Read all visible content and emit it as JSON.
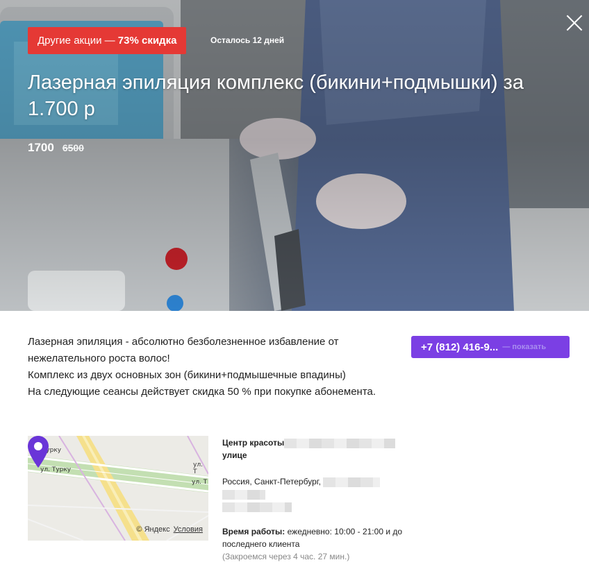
{
  "promo": {
    "badge_prefix": "Другие акции — ",
    "badge_discount": "73% скидка",
    "days_left": "Осталось 12 дней"
  },
  "offer": {
    "title": "Лазерная эпиляция комплекс (бикини+подмышки) за 1.700 р",
    "price_new": "1700",
    "price_old": "6500"
  },
  "description": [
    "Лазерная эпиляция - абсолютно безболезненное избавление от нежелательного роста волос!",
    "Комплекс из двух основных зон (бикини+подмышечные впадины)",
    "На следующие сеансы действует скидка 50 % при покупке абонемента."
  ],
  "phone": {
    "number": "+7 (812) 416-9...",
    "show_label": "— показать"
  },
  "map": {
    "street_1": "ул. Турку",
    "street_2": "ул. Турку",
    "street_3": "ул. Т",
    "street_4": "ул. Т",
    "copyright": "© Яндекс",
    "terms": "Условия"
  },
  "venue": {
    "name_prefix": "Центр красоты",
    "name_suffix": "улице",
    "address_prefix": "Россия, Санкт-Петербург,",
    "hours_label": "Время работы:",
    "hours_value": "ежедневно: 10:00 - 21:00 и до последнего клиента",
    "closing": "(Закроемся через 4 час. 27 мин.)"
  },
  "colors": {
    "accent_red": "#e53935",
    "accent_purple": "#7b3fe4",
    "map_pin": "#6a35d8"
  }
}
